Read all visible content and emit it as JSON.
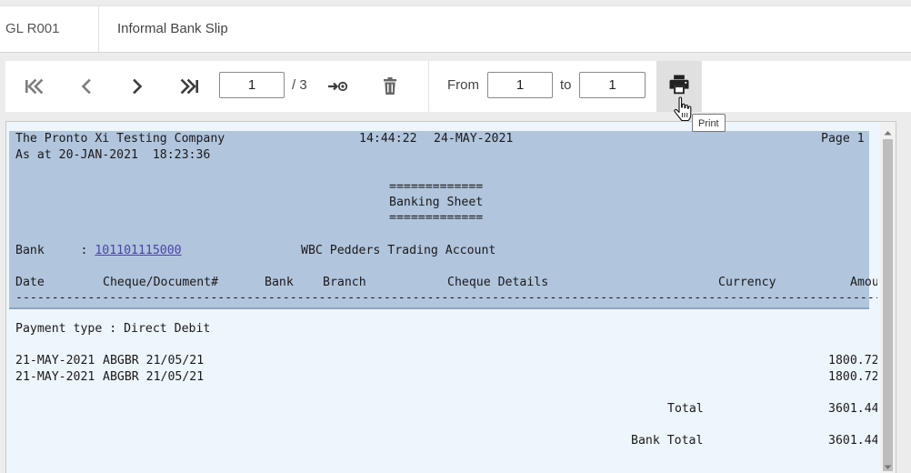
{
  "header": {
    "report_code": "GL R001",
    "report_title": "Informal Bank Slip"
  },
  "toolbar": {
    "first_icon": "first-page-icon",
    "prev_icon": "chevron-left-icon",
    "next_icon": "chevron-right-icon",
    "last_icon": "last-page-icon",
    "current_page": "1",
    "total_pages_label": "/ 3",
    "goto_icon": "go-to-page-icon",
    "delete_icon": "trash-icon",
    "from_label": "From",
    "from_value": "1",
    "to_label": "to",
    "to_value": "1",
    "print_icon": "printer-icon",
    "print_tooltip": "Print"
  },
  "report": {
    "company": "The Pronto Xi Testing Company",
    "time": "14:44:22",
    "date": "24-MAY-2021",
    "page_label": "Page 1",
    "as_at": "As at 20-JAN-2021  18:23:36",
    "separator_top": "=============",
    "sheet_title": "Banking Sheet",
    "separator_bottom": "=============",
    "bank_label": "Bank     : ",
    "bank_number": "101101115000",
    "bank_name": "WBC Pedders Trading Account",
    "columns": {
      "date": "Date",
      "cheque_document": "Cheque/Document#",
      "bank": "Bank",
      "branch": "Branch",
      "cheque_details": "Cheque Details",
      "currency": "Currency",
      "amount": "Amou"
    },
    "payment_type": "Payment type : Direct Debit",
    "rows": [
      {
        "date": "21-MAY-2021",
        "document": "ABGBR 21/05/21",
        "amount": "1800.72"
      },
      {
        "date": "21-MAY-2021",
        "document": "ABGBR 21/05/21",
        "amount": "1800.72"
      }
    ],
    "total_label": "Total",
    "total_value": "3601.44",
    "bank_total_label": "Bank Total",
    "bank_total_value": "3601.44"
  }
}
